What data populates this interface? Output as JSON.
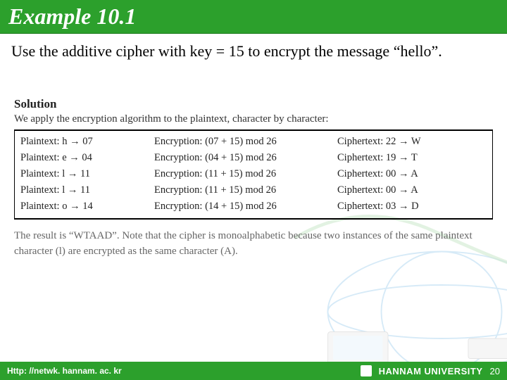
{
  "header": {
    "title": "Example 10.1"
  },
  "instruction": "Use the additive cipher with key = 15 to encrypt the message “hello”.",
  "solution": {
    "heading": "Solution",
    "intro": "We apply the encryption algorithm to the plaintext, character by character:",
    "rows": [
      {
        "plain": "Plaintext: h → 07",
        "enc": "Encryption: (07 + 15) mod 26",
        "cipher": "Ciphertext: 22 → W"
      },
      {
        "plain": "Plaintext: e → 04",
        "enc": "Encryption: (04 + 15) mod 26",
        "cipher": "Ciphertext: 19 → T"
      },
      {
        "plain": "Plaintext: l → 11",
        "enc": "Encryption: (11 + 15) mod 26",
        "cipher": "Ciphertext: 00 → A"
      },
      {
        "plain": "Plaintext: l → 11",
        "enc": "Encryption: (11 + 15) mod 26",
        "cipher": "Ciphertext: 00 → A"
      },
      {
        "plain": "Plaintext: o → 14",
        "enc": "Encryption: (14 + 15) mod 26",
        "cipher": "Ciphertext: 03 → D"
      }
    ],
    "result": "The result is “WTAAD”. Note that the cipher is monoalphabetic because two instances of the same plaintext character (l) are encrypted as the same character (A)."
  },
  "footer": {
    "url": "Http: //netwk. hannam. ac. kr",
    "university": "HANNAM  UNIVERSITY",
    "page": "20"
  }
}
